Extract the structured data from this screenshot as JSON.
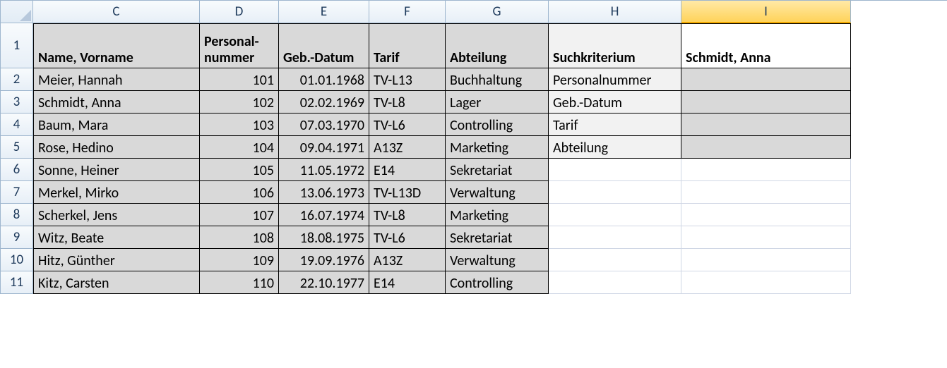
{
  "columns": [
    "C",
    "D",
    "E",
    "F",
    "G",
    "H",
    "I"
  ],
  "rowNumbers": [
    "1",
    "2",
    "3",
    "4",
    "5",
    "6",
    "7",
    "8",
    "9",
    "10",
    "11"
  ],
  "activeColumn": "I",
  "headers": {
    "C": "Name, Vorname",
    "D": "Personal-\nnummer",
    "E": "Geb.-Datum",
    "F": "Tarif",
    "G": "Abteilung",
    "H": "Suchkriterium",
    "I": "Schmidt, Anna"
  },
  "rows": [
    {
      "name": "Meier, Hannah",
      "num": "101",
      "dob": "01.01.1968",
      "tarif": "TV-L13",
      "abt": "Buchhaltung"
    },
    {
      "name": "Schmidt, Anna",
      "num": "102",
      "dob": "02.02.1969",
      "tarif": "TV-L8",
      "abt": "Lager"
    },
    {
      "name": "Baum, Mara",
      "num": "103",
      "dob": "07.03.1970",
      "tarif": "TV-L6",
      "abt": "Controlling"
    },
    {
      "name": "Rose, Hedino",
      "num": "104",
      "dob": "09.04.1971",
      "tarif": "A13Z",
      "abt": "Marketing"
    },
    {
      "name": "Sonne, Heiner",
      "num": "105",
      "dob": "11.05.1972",
      "tarif": "E14",
      "abt": "Sekretariat"
    },
    {
      "name": "Merkel, Mirko",
      "num": "106",
      "dob": "13.06.1973",
      "tarif": "TV-L13D",
      "abt": "Verwaltung"
    },
    {
      "name": "Scherkel, Jens",
      "num": "107",
      "dob": "16.07.1974",
      "tarif": "TV-L8",
      "abt": "Marketing"
    },
    {
      "name": "Witz, Beate",
      "num": "108",
      "dob": "18.08.1975",
      "tarif": "TV-L6",
      "abt": "Sekretariat"
    },
    {
      "name": "Hitz, Günther",
      "num": "109",
      "dob": "19.09.1976",
      "tarif": "A13Z",
      "abt": "Verwaltung"
    },
    {
      "name": "Kitz, Carsten",
      "num": "110",
      "dob": "22.10.1977",
      "tarif": "E14",
      "abt": "Controlling"
    }
  ],
  "suchkriterien": [
    "Personalnummer",
    "Geb.-Datum",
    "Tarif",
    "Abteilung"
  ],
  "results": [
    "",
    "",
    "",
    ""
  ]
}
